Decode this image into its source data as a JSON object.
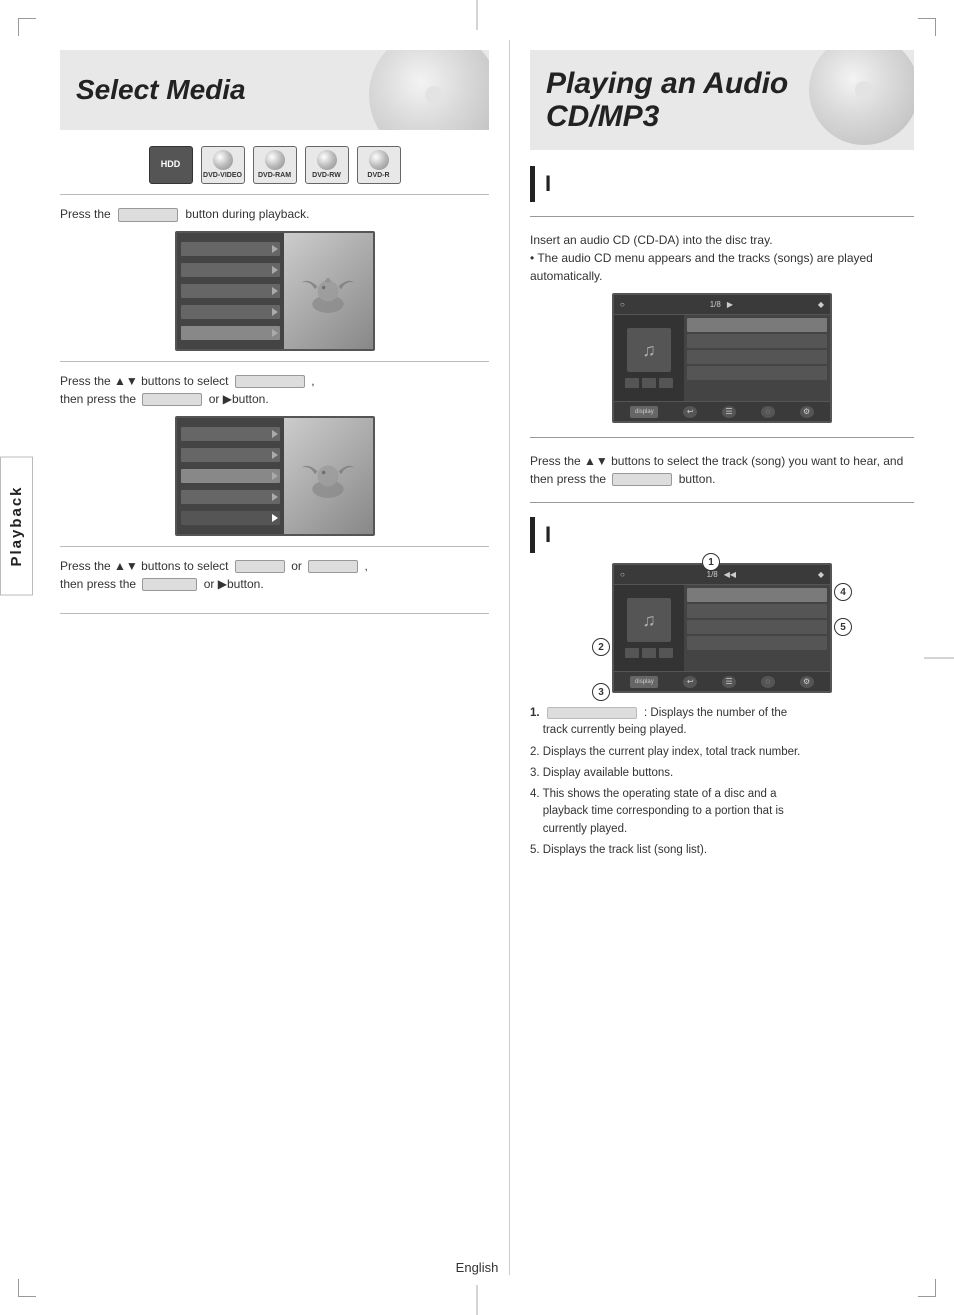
{
  "left": {
    "title": "Select Media",
    "media_icons": [
      {
        "label": "HDD",
        "type": "hdd"
      },
      {
        "label": "DVD-VIDEO",
        "type": "disc"
      },
      {
        "label": "DVD-RAM",
        "type": "disc"
      },
      {
        "label": "DVD-RW",
        "type": "disc"
      },
      {
        "label": "DVD-R",
        "type": "disc"
      }
    ],
    "instruction1": "Press the",
    "instruction1b": "button during playback.",
    "instruction2_a": "Press the ▲▼ buttons to select",
    "instruction2_b": "then press the",
    "instruction2_c": "or ▶button.",
    "instruction3_a": "Press the ▲▼ buttons to select",
    "instruction3_b": "or",
    "instruction3_c": "then press the",
    "instruction3_d": "or ▶button."
  },
  "right": {
    "title": "Playing an Audio CD/MP3",
    "step1_label": "I",
    "step1_text": "Insert an audio CD (CD-DA) into the disc tray.",
    "step1_sub": "• The audio CD menu appears and the tracks (songs) are played automatically.",
    "step2_instruction": "Press the ▲▼ buttons to select the track (song) you want to hear, and then press the",
    "step2_instruction2": "button.",
    "step2_label": "I",
    "numbered_items": [
      {
        "num": "1",
        "desc": ": Displays the number of the track currently being played."
      },
      {
        "num": "2",
        "desc": "Displays the current play index, total track number."
      },
      {
        "num": "3",
        "desc": "Display available buttons."
      },
      {
        "num": "4",
        "desc": "This shows the operating state of a disc and a playback time corresponding to a portion that is currently played."
      },
      {
        "num": "5",
        "desc": "Displays the track list (song list)."
      }
    ]
  },
  "footer": {
    "language": "English"
  },
  "sidebar": {
    "label": "Playback"
  }
}
